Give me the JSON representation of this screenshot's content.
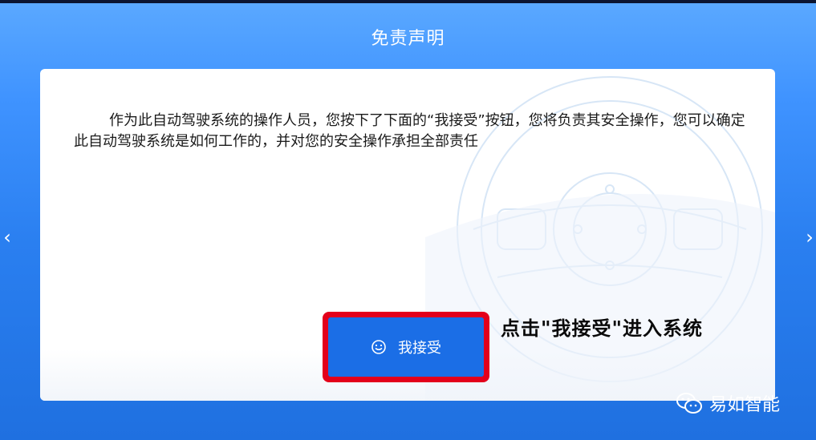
{
  "dialog": {
    "title": "免责声明",
    "statement": "作为此自动驾驶系统的操作人员，您按下了下面的“我接受”按钮，您将负责其安全操作，您可以确定此自动驾驶系统是如何工作的，并对您的安全操作承担全部责任",
    "accept_button_label": "我接受",
    "accept_button_icon": "smile-icon"
  },
  "annotation": {
    "text": "点击\"我接受\"进入系统",
    "highlight_color": "#e3001b"
  },
  "watermark": {
    "icon": "wechat-icon",
    "text": "易如智能"
  },
  "nav": {
    "left_icon": "chevron-left-icon",
    "right_icon": "chevron-right-icon"
  },
  "colors": {
    "primary": "#1b6ee6",
    "header_bg": "#3f93ff"
  }
}
